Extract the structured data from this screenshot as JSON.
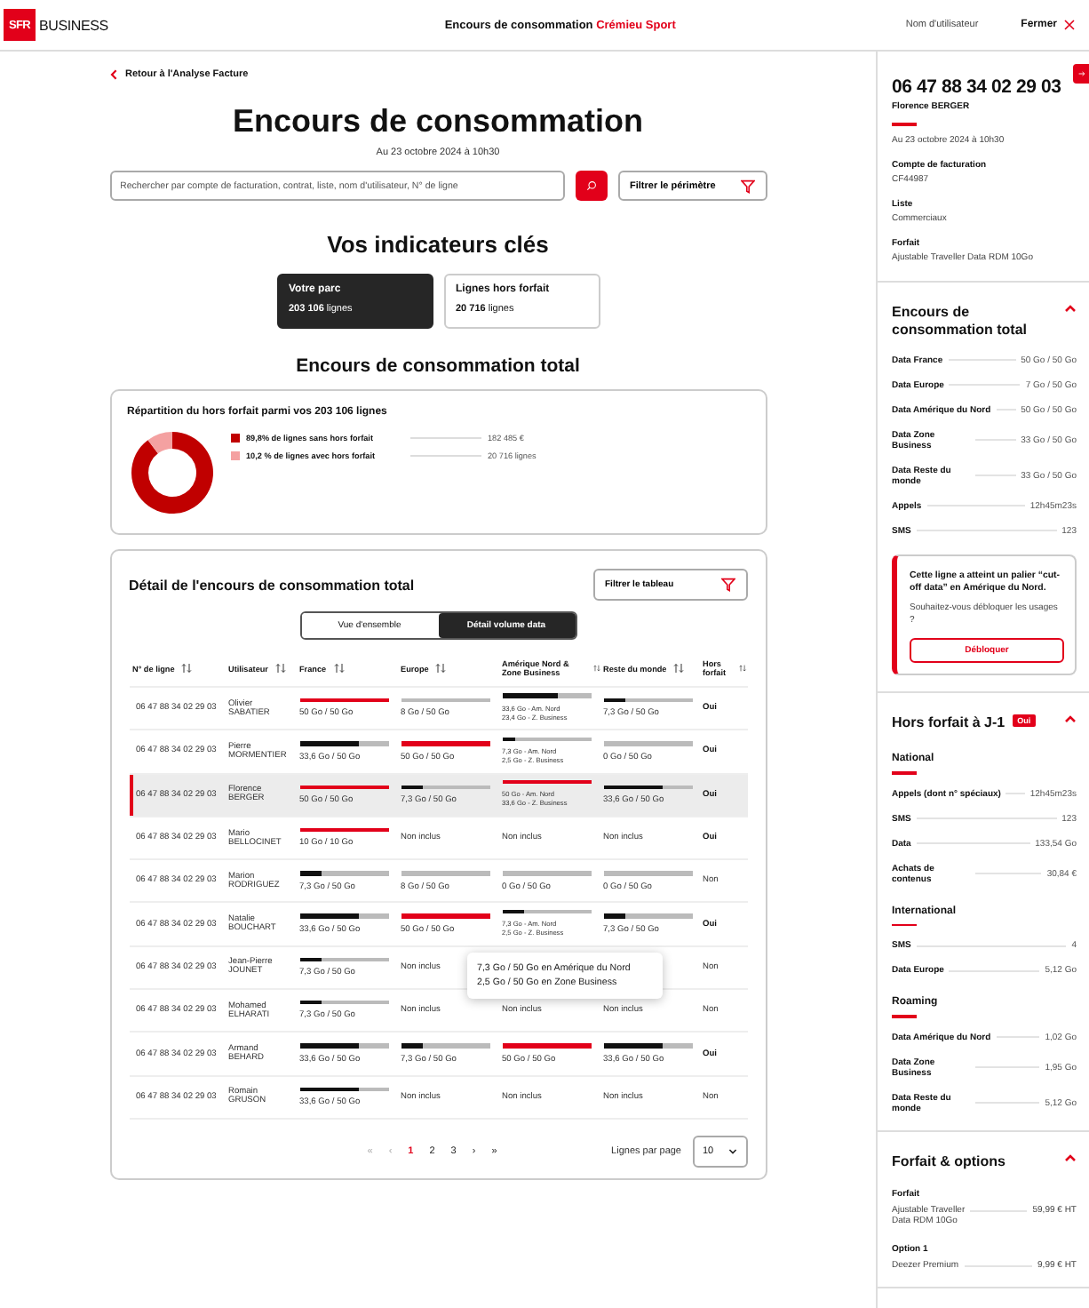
{
  "header": {
    "logo": "SFR",
    "brand": "BUSINESS",
    "title": "Encours de consommation",
    "company": "Crémieu Sport",
    "user": "Nom d'utilisateur",
    "close": "Fermer"
  },
  "back_link": "Retour à l'Analyse Facture",
  "title": "Encours de consommation",
  "date": "Au 23 octobre 2024 à 10h30",
  "search": {
    "placeholder": "Rechercher par compte de facturation, contrat, liste, nom d'utilisateur, N° de ligne"
  },
  "filter_button": "Filtrer le périmètre",
  "indicators": {
    "title": "Vos indicateurs clés",
    "cards": [
      {
        "label": "Votre parc",
        "value": "203 106",
        "unit": "lignes",
        "selected": true
      },
      {
        "label": "Lignes hors forfait",
        "value": "20 716",
        "unit": "lignes",
        "selected": false
      }
    ]
  },
  "section_title": "Encours de consommation total",
  "distribution": {
    "title": "Répartition du hors forfait parmi vos 203 106 lignes",
    "chart_data": {
      "type": "donut",
      "categories": [
        "89,8% de lignes sans hors forfait",
        "10,2 % de lignes avec hors forfait"
      ],
      "series": [
        {
          "values": [
            89.8,
            10.2
          ]
        }
      ]
    },
    "legend": [
      {
        "value": "182 485 €",
        "color": "#c00000"
      },
      {
        "value": "20 716 lignes",
        "color": "#f4a1a1"
      }
    ]
  },
  "detail": {
    "title": "Détail de l'encours de consommation total",
    "filter_button": "Filtrer le tableau",
    "views": [
      {
        "label": "Vue d'ensemble",
        "selected": false
      },
      {
        "label": "Détail volume data",
        "selected": true
      }
    ],
    "columns": [
      "N° de ligne",
      "Utilisateur",
      "France",
      "Europe",
      "Amérique Nord & Zone Business",
      "Reste du monde",
      "Hors forfait"
    ],
    "rows": [
      {
        "selected": false,
        "cells": [
          {
            "kind": "text",
            "text": "06 47 88 34 02 29 03"
          },
          {
            "kind": "user",
            "text": "Olivier SABATIER"
          },
          {
            "kind": "bar",
            "level": 1,
            "over": true,
            "text": "50 Go / 50 Go"
          },
          {
            "kind": "bar",
            "level": 0,
            "text": "8 Go / 50 Go"
          },
          {
            "kind": "split",
            "level": 0.62,
            "over": false,
            "lines": [
              "33,6 Go - Am. Nord",
              "23,4 Go - Z. Business"
            ]
          },
          {
            "kind": "bar",
            "level": 0.25,
            "over": false,
            "text": "7,3 Go / 50 Go"
          },
          {
            "kind": "flag",
            "text": "Oui",
            "on": true
          }
        ]
      },
      {
        "selected": false,
        "cells": [
          {
            "kind": "text",
            "text": "06 47 88 34 02 29 03"
          },
          {
            "kind": "user",
            "text": "Pierre MORMENTIER"
          },
          {
            "kind": "bar",
            "level": 0.67,
            "over": false,
            "text": "33,6 Go / 50 Go"
          },
          {
            "kind": "bar",
            "level": 1,
            "over": true,
            "text": "50 Go / 50 Go"
          },
          {
            "kind": "split",
            "level": 0.15,
            "over": false,
            "lines": [
              "7,3 Go - Am. Nord",
              "2,5 Go - Z. Business"
            ]
          },
          {
            "kind": "bar",
            "level": 0,
            "text": "0 Go / 50 Go"
          },
          {
            "kind": "flag",
            "text": "Oui",
            "on": true
          }
        ]
      },
      {
        "selected": true,
        "cells": [
          {
            "kind": "text",
            "text": "06 47 88 34 02 29 03"
          },
          {
            "kind": "user",
            "text": "Florence BERGER"
          },
          {
            "kind": "bar",
            "level": 1,
            "over": true,
            "text": "50 Go / 50 Go"
          },
          {
            "kind": "bar",
            "level": 0.25,
            "over": false,
            "text": "7,3 Go / 50 Go"
          },
          {
            "kind": "split",
            "level": 1,
            "over": true,
            "lines": [
              "50 Go - Am. Nord",
              "33,6 Go - Z. Business"
            ]
          },
          {
            "kind": "bar",
            "level": 0.67,
            "over": false,
            "text": "33,6 Go / 50 Go"
          },
          {
            "kind": "flag",
            "text": "Oui",
            "on": true
          }
        ]
      },
      {
        "selected": false,
        "cells": [
          {
            "kind": "text",
            "text": "06 47 88 34 02 29 03"
          },
          {
            "kind": "user",
            "text": "Mario BELLOCINET"
          },
          {
            "kind": "bar",
            "level": 1,
            "over": true,
            "text": "10 Go / 10 Go"
          },
          {
            "kind": "text",
            "text": "Non inclus"
          },
          {
            "kind": "text",
            "text": "Non inclus"
          },
          {
            "kind": "text",
            "text": "Non inclus"
          },
          {
            "kind": "flag",
            "text": "Oui",
            "on": true
          }
        ]
      },
      {
        "selected": false,
        "cells": [
          {
            "kind": "text",
            "text": "06 47 88 34 02 29 03"
          },
          {
            "kind": "user",
            "text": "Marion RODRIGUEZ"
          },
          {
            "kind": "bar",
            "level": 0.25,
            "over": false,
            "text": "7,3 Go / 50 Go"
          },
          {
            "kind": "bar",
            "level": 0,
            "text": "8 Go / 50 Go"
          },
          {
            "kind": "bar",
            "level": 0,
            "text": "0 Go / 50 Go"
          },
          {
            "kind": "bar",
            "level": 0,
            "text": "0 Go / 50 Go"
          },
          {
            "kind": "flag",
            "text": "Non",
            "on": false
          }
        ]
      },
      {
        "selected": false,
        "cells": [
          {
            "kind": "text",
            "text": "06 47 88 34 02 29 03"
          },
          {
            "kind": "user",
            "text": "Natalie BOUCHART"
          },
          {
            "kind": "bar",
            "level": 0.67,
            "over": false,
            "text": "33,6 Go / 50 Go"
          },
          {
            "kind": "bar",
            "level": 1,
            "over": true,
            "text": "50 Go / 50 Go"
          },
          {
            "kind": "split",
            "level": 0.25,
            "over": false,
            "lines": [
              "7,3 Go - Am. Nord",
              "2,5 Go - Z. Business"
            ]
          },
          {
            "kind": "bar",
            "level": 0.25,
            "over": false,
            "text": "7,3 Go / 50 Go"
          },
          {
            "kind": "flag",
            "text": "Oui",
            "on": true
          }
        ]
      },
      {
        "selected": false,
        "cells": [
          {
            "kind": "text",
            "text": "06 47 88 34 02 29 03"
          },
          {
            "kind": "user",
            "text": "Jean-Pierre JOUNET"
          },
          {
            "kind": "bar",
            "level": 0.25,
            "over": false,
            "text": "7,3 Go / 50 Go"
          },
          {
            "kind": "text",
            "text": "Non inclus"
          },
          null,
          null,
          {
            "kind": "flag",
            "text": "Non",
            "on": false
          }
        ]
      },
      {
        "selected": false,
        "cells": [
          {
            "kind": "text",
            "text": "06 47 88 34 02 29 03"
          },
          {
            "kind": "user",
            "text": "Mohamed ELHARATI"
          },
          {
            "kind": "bar",
            "level": 0.25,
            "over": false,
            "text": "7,3 Go / 50 Go"
          },
          {
            "kind": "text",
            "text": "Non inclus"
          },
          {
            "kind": "text",
            "text": "Non inclus"
          },
          {
            "kind": "text",
            "text": "Non inclus"
          },
          {
            "kind": "flag",
            "text": "Non",
            "on": false
          }
        ]
      },
      {
        "selected": false,
        "cells": [
          {
            "kind": "text",
            "text": "06 47 88 34 02 29 03"
          },
          {
            "kind": "user",
            "text": "Armand BEHARD"
          },
          {
            "kind": "bar",
            "level": 0.67,
            "over": false,
            "text": "33,6 Go / 50 Go"
          },
          {
            "kind": "bar",
            "level": 0.25,
            "over": false,
            "text": "7,3 Go / 50 Go"
          },
          {
            "kind": "bar",
            "level": 1,
            "over": true,
            "text": "50 Go / 50 Go"
          },
          {
            "kind": "bar",
            "level": 0.67,
            "over": false,
            "text": "33,6 Go / 50 Go"
          },
          {
            "kind": "flag",
            "text": "Oui",
            "on": true
          }
        ]
      },
      {
        "selected": false,
        "cells": [
          {
            "kind": "text",
            "text": "06 47 88 34 02 29 03"
          },
          {
            "kind": "user",
            "text": "Romain GRUSON"
          },
          {
            "kind": "bar",
            "level": 0.67,
            "over": false,
            "text": "33,6 Go / 50 Go"
          },
          {
            "kind": "text",
            "text": "Non inclus"
          },
          {
            "kind": "text",
            "text": "Non inclus"
          },
          {
            "kind": "text",
            "text": "Non inclus"
          },
          {
            "kind": "flag",
            "text": "Non",
            "on": false
          }
        ]
      }
    ],
    "tooltip": [
      "7,3 Go / 50 Go en Amérique du Nord",
      "2,5 Go / 50 Go en Zone Business"
    ],
    "pagination": {
      "first": "«",
      "prev": "‹",
      "pages": [
        {
          "label": "1",
          "selected": true
        },
        {
          "label": "2",
          "selected": false
        },
        {
          "label": "3",
          "selected": false
        }
      ],
      "next": "›",
      "last": "»",
      "per_page_label": "Lignes par page",
      "per_page": "10"
    }
  },
  "panel": {
    "phone": "06 47 88 34 02 29 03",
    "name": "Florence BERGER",
    "date": "Au 23 octobre 2024 à 10h30",
    "fields": [
      {
        "label": "Compte de facturation",
        "value": "CF44987"
      },
      {
        "label": "Liste",
        "value": "Commerciaux"
      },
      {
        "label": "Forfait",
        "value": "Ajustable Traveller Data RDM 10Go"
      }
    ],
    "sections": [
      {
        "title": "Encours de consommation total",
        "expanded": true,
        "rows": [
          {
            "label": "Data France",
            "value": "50 Go / 50 Go"
          },
          {
            "label": "Data Europe",
            "value": "7 Go / 50 Go"
          },
          {
            "label": "Data Amérique du Nord",
            "value": "50 Go / 50 Go"
          },
          {
            "label": "Data Zone Business",
            "value": "33 Go / 50 Go"
          },
          {
            "label": "Data Reste du monde",
            "value": "33 Go / 50 Go"
          },
          {
            "label": "Appels",
            "value": "12h45m23s"
          },
          {
            "label": "SMS",
            "value": "123"
          }
        ],
        "alert": {
          "title": "Cette ligne a atteint un palier “cut-off data” en Amérique du Nord.",
          "text": "Souhaitez-vous débloquer les usages ?",
          "button": "Débloquer"
        }
      },
      {
        "title": "Hors forfait à J-1",
        "badge": "Oui",
        "expanded": true,
        "groups": [
          {
            "title": "National",
            "rows": [
              {
                "label": "Appels (dont n° spéciaux)",
                "value": "12h45m23s"
              },
              {
                "label": "SMS",
                "value": "123"
              },
              {
                "label": "Data",
                "value": "133,54 Go"
              },
              {
                "label": "Achats de contenus",
                "value": "30,84 €"
              }
            ]
          },
          {
            "title": "International",
            "rows": [
              {
                "label": "SMS",
                "value": "4"
              },
              {
                "label": "Data Europe",
                "value": "5,12 Go"
              }
            ]
          },
          {
            "title": "Roaming",
            "rows": [
              {
                "label": "Data Amérique du Nord",
                "value": "1,02 Go"
              },
              {
                "label": "Data Zone Business",
                "value": "1,95 Go"
              },
              {
                "label": "Data Reste du monde",
                "value": "5,12 Go"
              }
            ]
          }
        ]
      },
      {
        "title": "Forfait & options",
        "expanded": true,
        "items": [
          {
            "label": "Forfait",
            "lines": [
              "Ajustable Traveller",
              "Data RDM 10Go"
            ],
            "value": "59,99 € HT"
          },
          {
            "label": "Option 1",
            "lines": [
              "Deezer Premium"
            ],
            "value": "9,99 € HT"
          }
        ]
      }
    ]
  }
}
